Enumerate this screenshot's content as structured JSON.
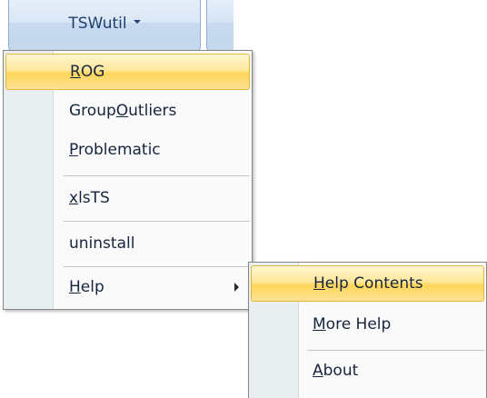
{
  "ribbon": {
    "button_label": "TSWutil"
  },
  "main_menu": {
    "items": [
      {
        "pre": "",
        "accel": "R",
        "post": "OG"
      },
      {
        "pre": "Group",
        "accel": "O",
        "post": "utliers"
      },
      {
        "pre": "",
        "accel": "P",
        "post": "roblematic"
      },
      {
        "pre": "",
        "accel": "x",
        "post": "lsTS"
      },
      {
        "pre": "uninstall",
        "accel": "",
        "post": ""
      },
      {
        "pre": "",
        "accel": "H",
        "post": "elp"
      }
    ]
  },
  "help_menu": {
    "items": [
      {
        "pre": "",
        "accel": "H",
        "post": "elp Contents"
      },
      {
        "pre": "",
        "accel": "M",
        "post": "ore Help"
      },
      {
        "pre": "",
        "accel": "A",
        "post": "bout"
      }
    ]
  },
  "colors": {
    "highlight": "#ffd55a",
    "ribbon": "#c8daf0",
    "gutter": "#e9eef0"
  },
  "icons": {
    "ribbon_dropdown": "chevron-down-icon",
    "submenu": "chevron-right-icon"
  }
}
